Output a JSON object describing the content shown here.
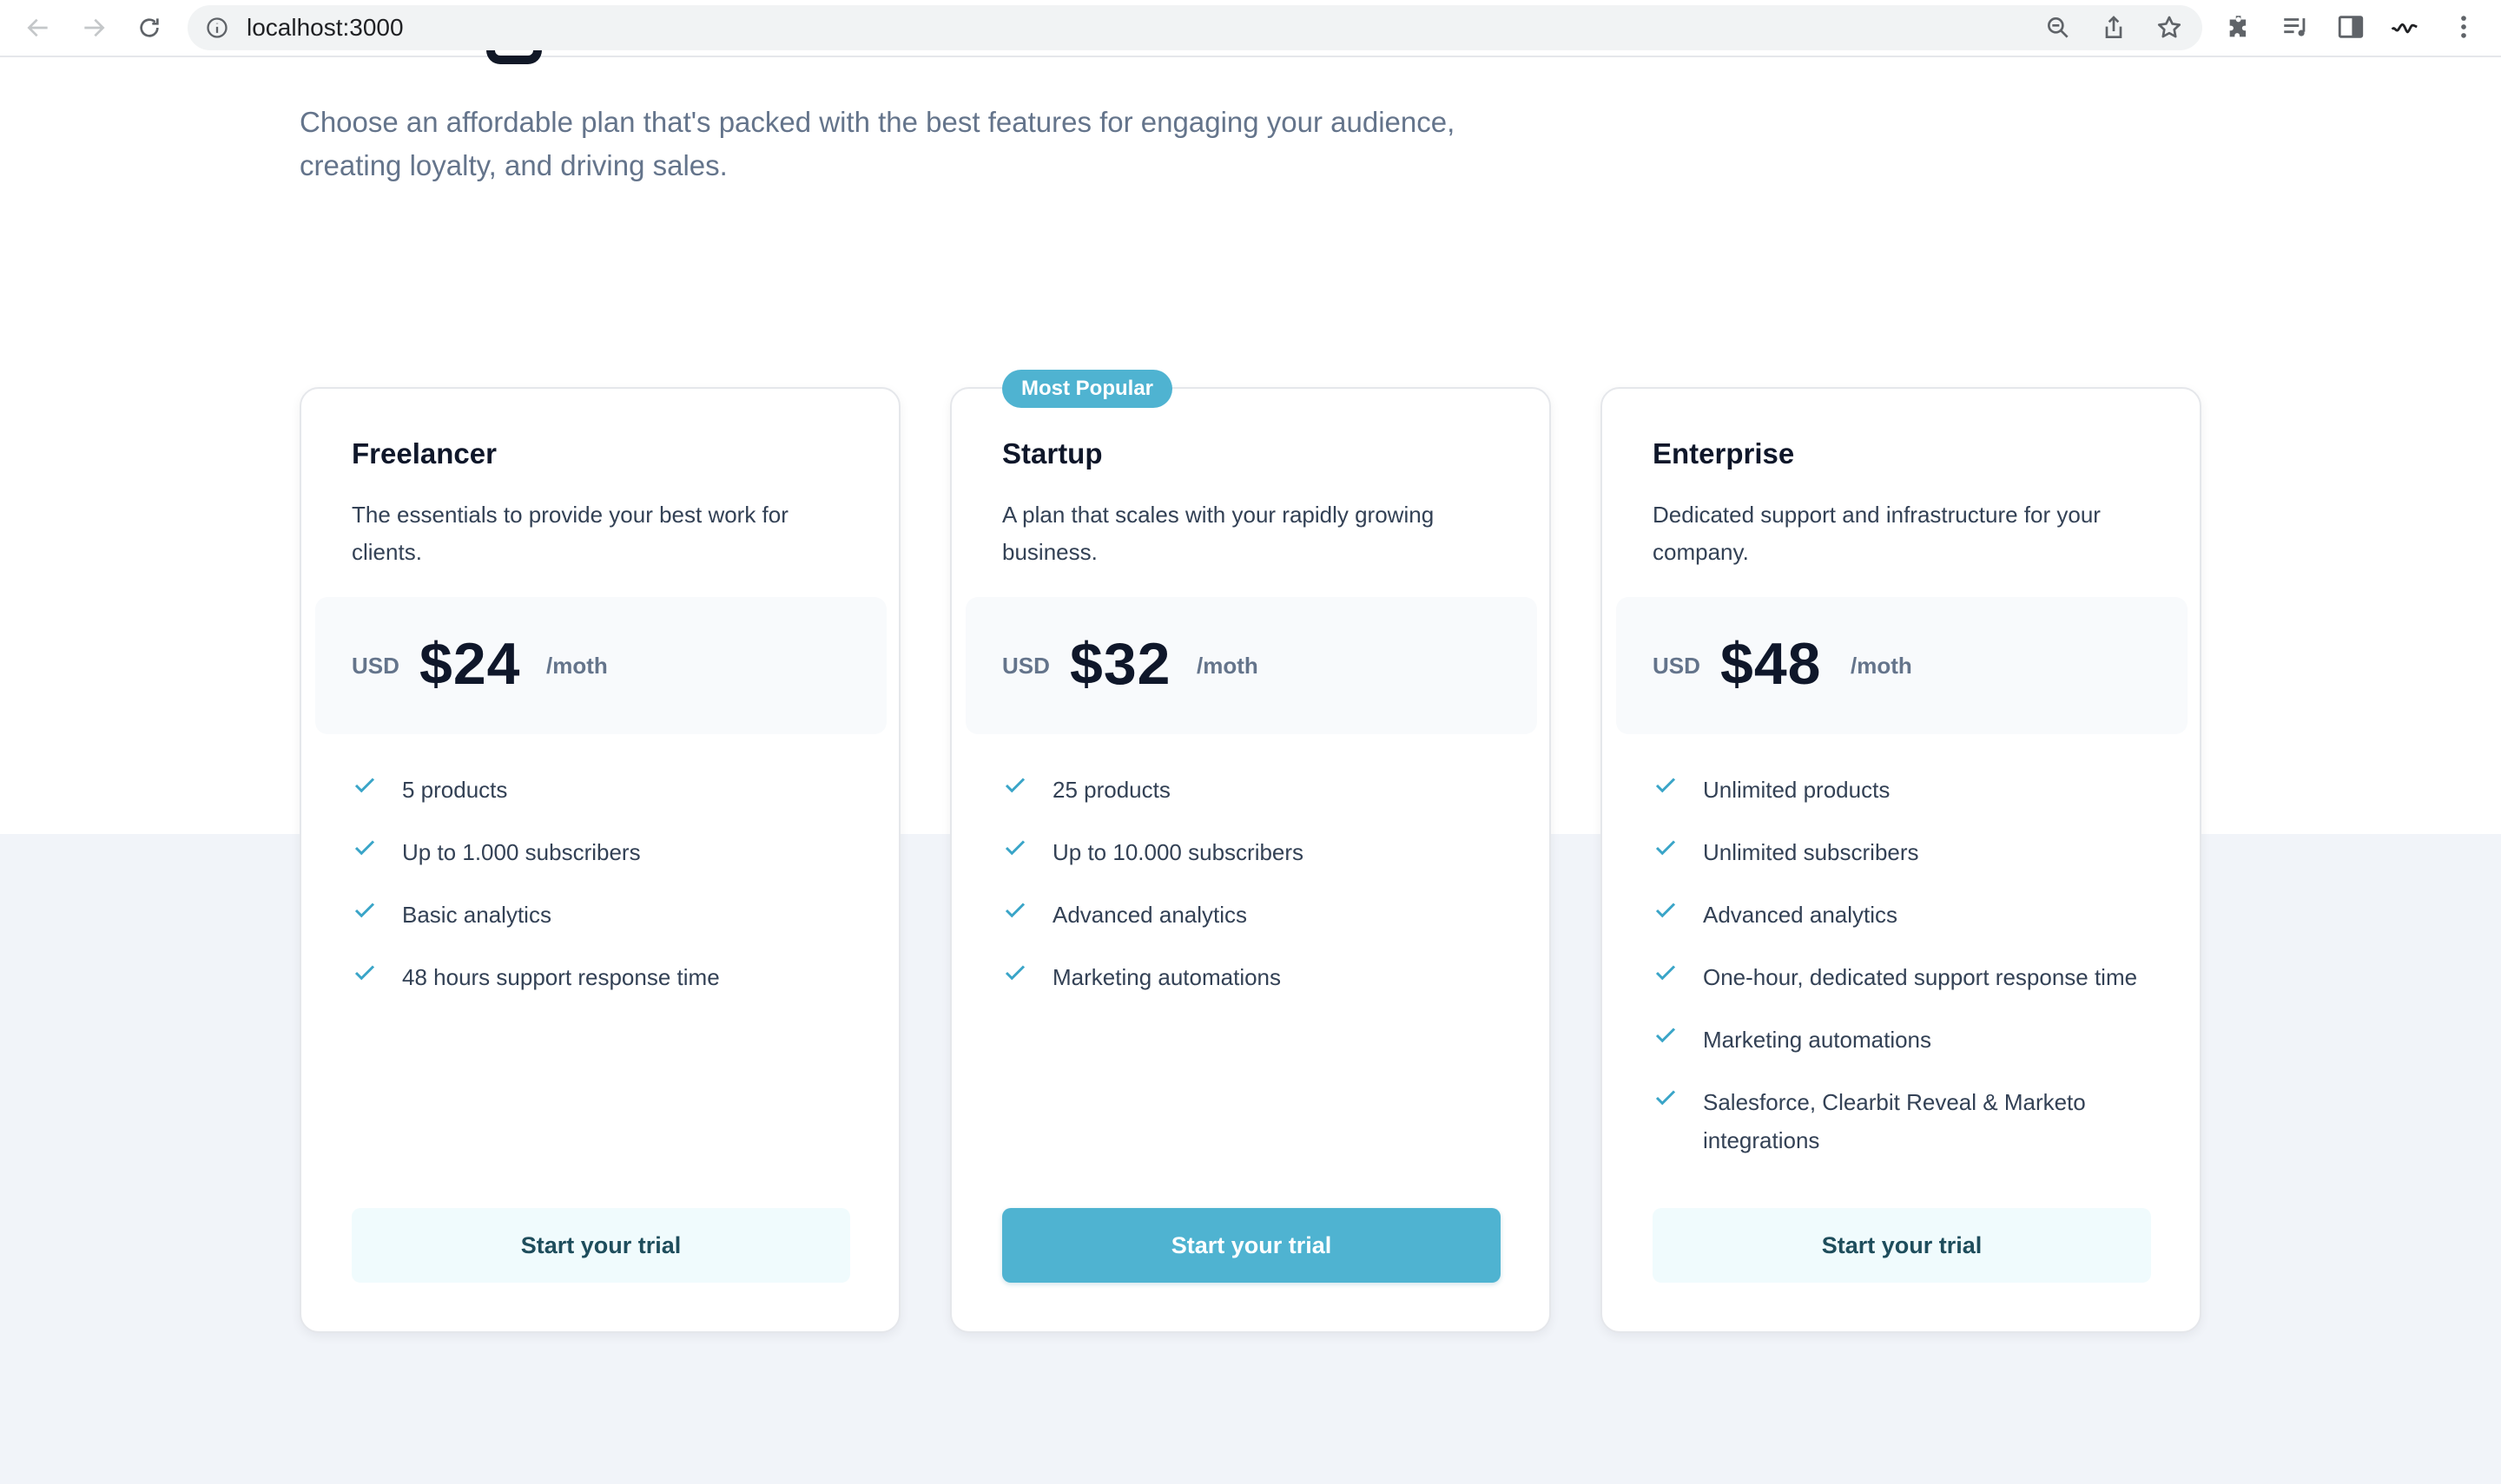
{
  "browser": {
    "url": "localhost:3000"
  },
  "hero": {
    "lead": "Choose an affordable plan that's packed with the best features for engaging your audience, creating loyalty, and driving sales."
  },
  "colors": {
    "accent": "#4fb3d1",
    "check": "#3aa5c8",
    "band": "#f1f4f9"
  },
  "plans": [
    {
      "name": "Freelancer",
      "description": "The essentials to provide your best work for clients.",
      "currency": "USD",
      "price": "$24",
      "period": "/moth",
      "features": [
        "5 products",
        "Up to 1.000 subscribers",
        "Basic analytics",
        "48 hours support response time"
      ],
      "cta": "Start your trial"
    },
    {
      "name": "Startup",
      "badge": "Most Popular",
      "description": "A plan that scales with your rapidly growing business.",
      "currency": "USD",
      "price": "$32",
      "period": "/moth",
      "features": [
        "25 products",
        "Up to 10.000 subscribers",
        "Advanced analytics",
        "Marketing automations"
      ],
      "cta": "Start your trial"
    },
    {
      "name": "Enterprise",
      "description": "Dedicated support and infrastructure for your company.",
      "currency": "USD",
      "price": "$48",
      "period": "/moth",
      "features": [
        "Unlimited products",
        "Unlimited subscribers",
        "Advanced analytics",
        "One-hour, dedicated support response time",
        "Marketing automations",
        "Salesforce, Clearbit Reveal & Marketo integrations"
      ],
      "cta": "Start your trial"
    }
  ]
}
